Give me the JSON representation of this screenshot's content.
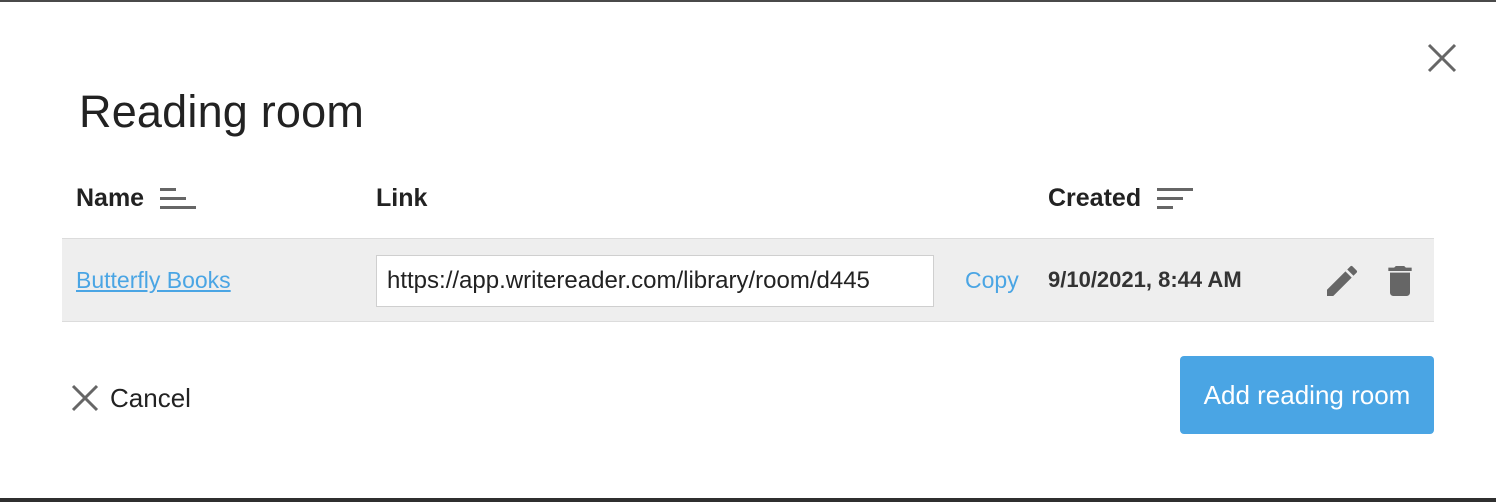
{
  "dialog": {
    "title": "Reading room",
    "close_icon": "close-icon"
  },
  "table": {
    "columns": [
      {
        "label": "Name",
        "sort_icon": "sort-ascending-icon"
      },
      {
        "label": "Link"
      },
      {
        "label": "Created",
        "sort_icon": "sort-descending-icon"
      }
    ],
    "rows": [
      {
        "name": "Butterfly Books",
        "link": "https://app.writereader.com/library/room/d445",
        "copy_label": "Copy",
        "created": "9/10/2021, 8:44 AM",
        "edit_icon": "pencil-icon",
        "delete_icon": "trash-icon"
      }
    ]
  },
  "footer": {
    "cancel_label": "Cancel",
    "add_label": "Add reading room"
  },
  "colors": {
    "accent": "#4aa5e4",
    "row_background": "#eeeeee",
    "icon": "#666666"
  }
}
